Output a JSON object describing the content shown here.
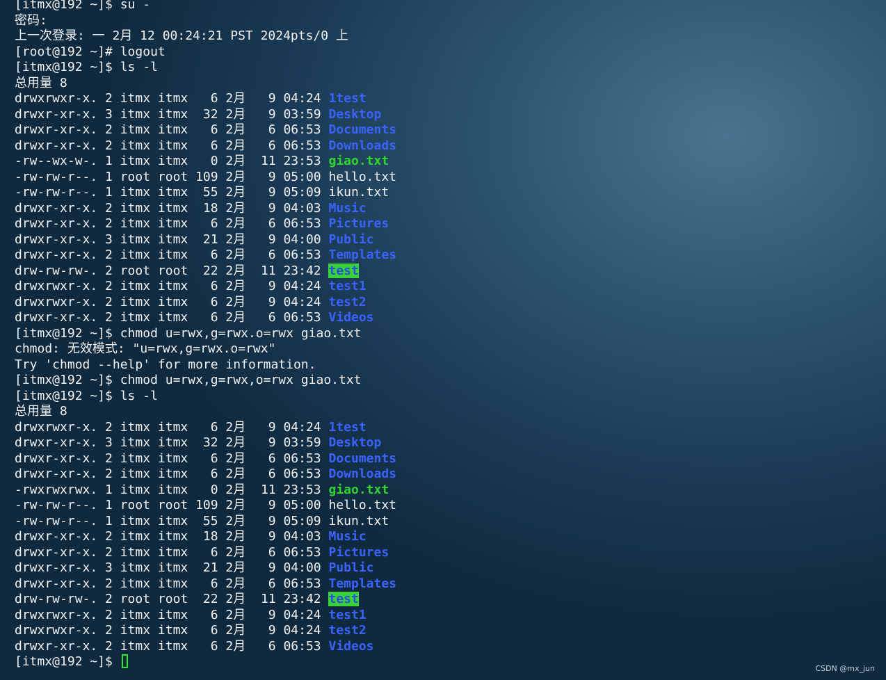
{
  "colors": {
    "background": "#2e5671",
    "text": "#f2f2f2",
    "directory": "#3b62ff",
    "executable": "#2ed62e",
    "sticky_highlight_bg": "#3ad23a",
    "cursor": "#2ee82e"
  },
  "terminal": {
    "lines": [
      {
        "text": "[itmx@192 ~]$ su -"
      },
      {
        "text": "密码:"
      },
      {
        "text": "上一次登录: 一 2月 12 00:24:21 PST 2024pts/0 上"
      },
      {
        "text": "[root@192 ~]# logout"
      },
      {
        "text": "[itmx@192 ~]$ ls -l"
      },
      {
        "text": "总用量 8"
      },
      {
        "prefix": "drwxrwxr-x. 2 itmx itmx   6 2月   9 04:24 ",
        "name": "1test",
        "kind": "dir"
      },
      {
        "prefix": "drwxr-xr-x. 3 itmx itmx  32 2月   9 03:59 ",
        "name": "Desktop",
        "kind": "dir"
      },
      {
        "prefix": "drwxr-xr-x. 2 itmx itmx   6 2月   6 06:53 ",
        "name": "Documents",
        "kind": "dir"
      },
      {
        "prefix": "drwxr-xr-x. 2 itmx itmx   6 2月   6 06:53 ",
        "name": "Downloads",
        "kind": "dir"
      },
      {
        "prefix": "-rw--wx-w-. 1 itmx itmx   0 2月  11 23:53 ",
        "name": "giao.txt",
        "kind": "exe"
      },
      {
        "prefix": "-rw-rw-r--. 1 root root 109 2月   9 05:00 ",
        "name": "hello.txt",
        "kind": "plain"
      },
      {
        "prefix": "-rw-rw-r--. 1 itmx itmx  55 2月   9 05:09 ",
        "name": "ikun.txt",
        "kind": "plain"
      },
      {
        "prefix": "drwxr-xr-x. 2 itmx itmx  18 2月   9 04:03 ",
        "name": "Music",
        "kind": "dir"
      },
      {
        "prefix": "drwxr-xr-x. 2 itmx itmx   6 2月   6 06:53 ",
        "name": "Pictures",
        "kind": "dir"
      },
      {
        "prefix": "drwxr-xr-x. 3 itmx itmx  21 2月   9 04:00 ",
        "name": "Public",
        "kind": "dir"
      },
      {
        "prefix": "drwxr-xr-x. 2 itmx itmx   6 2月   6 06:53 ",
        "name": "Templates",
        "kind": "dir"
      },
      {
        "prefix": "drw-rw-rw-. 2 root root  22 2月  11 23:42 ",
        "name": "test",
        "kind": "hl"
      },
      {
        "prefix": "drwxrwxr-x. 2 itmx itmx   6 2月   9 04:24 ",
        "name": "test1",
        "kind": "dir"
      },
      {
        "prefix": "drwxrwxr-x. 2 itmx itmx   6 2月   9 04:24 ",
        "name": "test2",
        "kind": "dir"
      },
      {
        "prefix": "drwxr-xr-x. 2 itmx itmx   6 2月   6 06:53 ",
        "name": "Videos",
        "kind": "dir"
      },
      {
        "text": "[itmx@192 ~]$ chmod u=rwx,g=rwx.o=rwx giao.txt"
      },
      {
        "text": "chmod: 无效模式: \"u=rwx,g=rwx.o=rwx\""
      },
      {
        "text": "Try 'chmod --help' for more information."
      },
      {
        "text": "[itmx@192 ~]$ chmod u=rwx,g=rwx,o=rwx giao.txt"
      },
      {
        "text": "[itmx@192 ~]$ ls -l"
      },
      {
        "text": "总用量 8"
      },
      {
        "prefix": "drwxrwxr-x. 2 itmx itmx   6 2月   9 04:24 ",
        "name": "1test",
        "kind": "dir"
      },
      {
        "prefix": "drwxr-xr-x. 3 itmx itmx  32 2月   9 03:59 ",
        "name": "Desktop",
        "kind": "dir"
      },
      {
        "prefix": "drwxr-xr-x. 2 itmx itmx   6 2月   6 06:53 ",
        "name": "Documents",
        "kind": "dir"
      },
      {
        "prefix": "drwxr-xr-x. 2 itmx itmx   6 2月   6 06:53 ",
        "name": "Downloads",
        "kind": "dir"
      },
      {
        "prefix": "-rwxrwxrwx. 1 itmx itmx   0 2月  11 23:53 ",
        "name": "giao.txt",
        "kind": "exe"
      },
      {
        "prefix": "-rw-rw-r--. 1 root root 109 2月   9 05:00 ",
        "name": "hello.txt",
        "kind": "plain"
      },
      {
        "prefix": "-rw-rw-r--. 1 itmx itmx  55 2月   9 05:09 ",
        "name": "ikun.txt",
        "kind": "plain"
      },
      {
        "prefix": "drwxr-xr-x. 2 itmx itmx  18 2月   9 04:03 ",
        "name": "Music",
        "kind": "dir"
      },
      {
        "prefix": "drwxr-xr-x. 2 itmx itmx   6 2月   6 06:53 ",
        "name": "Pictures",
        "kind": "dir"
      },
      {
        "prefix": "drwxr-xr-x. 3 itmx itmx  21 2月   9 04:00 ",
        "name": "Public",
        "kind": "dir"
      },
      {
        "prefix": "drwxr-xr-x. 2 itmx itmx   6 2月   6 06:53 ",
        "name": "Templates",
        "kind": "dir"
      },
      {
        "prefix": "drw-rw-rw-. 2 root root  22 2月  11 23:42 ",
        "name": "test",
        "kind": "hl"
      },
      {
        "prefix": "drwxrwxr-x. 2 itmx itmx   6 2月   9 04:24 ",
        "name": "test1",
        "kind": "dir"
      },
      {
        "prefix": "drwxrwxr-x. 2 itmx itmx   6 2月   9 04:24 ",
        "name": "test2",
        "kind": "dir"
      },
      {
        "prefix": "drwxr-xr-x. 2 itmx itmx   6 2月   6 06:53 ",
        "name": "Videos",
        "kind": "dir"
      }
    ],
    "prompt": "[itmx@192 ~]$ ",
    "cursor_icon": "block-cursor"
  },
  "watermark": "CSDN @mx_jun"
}
